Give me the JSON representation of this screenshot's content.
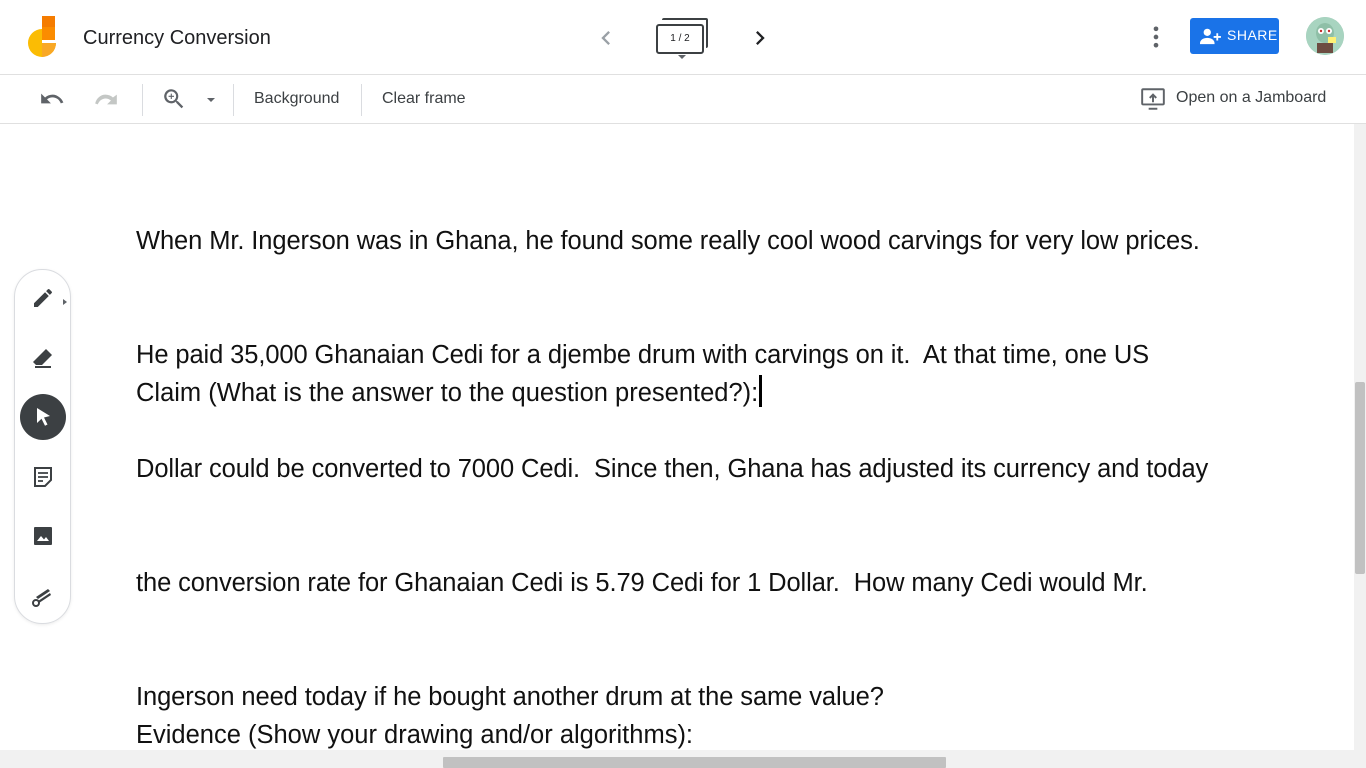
{
  "header": {
    "title": "Currency Conversion",
    "frame_indicator": "1 / 2",
    "share_label": "SHARE",
    "icons": {
      "logo": "jamboard-logo",
      "prev": "chevron-left-icon",
      "next": "chevron-right-icon",
      "more": "more-vert-icon",
      "share": "person-add-icon",
      "avatar": "user-avatar"
    }
  },
  "toolbar": {
    "background_label": "Background",
    "clear_frame_label": "Clear frame",
    "open_on_jamboard_label": "Open on a Jamboard",
    "icons": [
      "undo-icon",
      "redo-icon",
      "zoom-in-icon",
      "cast-icon"
    ]
  },
  "canvas": {
    "problem_lines": [
      "When Mr. Ingerson was in Ghana, he found some really cool wood carvings for very low prices.",
      "He paid 35,000 Ghanaian Cedi for a djembe drum with carvings on it.  At that time, one US",
      "Dollar could be converted to 7000 Cedi.  Since then, Ghana has adjusted its currency and today",
      "the conversion rate for Ghanaian Cedi is 5.79 Cedi for 1 Dollar.  How many Cedi would Mr.",
      "Ingerson need today if he bought another drum at the same value?"
    ],
    "claim_text": "Claim (What is the answer to the question presented?):",
    "evidence_text": "Evidence (Show your drawing and/or algorithms):"
  },
  "palette": {
    "tools": [
      "pen-icon",
      "eraser-icon",
      "select-arrow-icon",
      "sticky-note-icon",
      "image-icon",
      "laser-pointer-icon"
    ],
    "active_tool": "select-arrow-icon"
  },
  "colors": {
    "share_button": "#1a73e8",
    "logo_yellow": "#fbbc04",
    "logo_orange": "#f57c00",
    "active_tool_bg": "#3c4043"
  }
}
